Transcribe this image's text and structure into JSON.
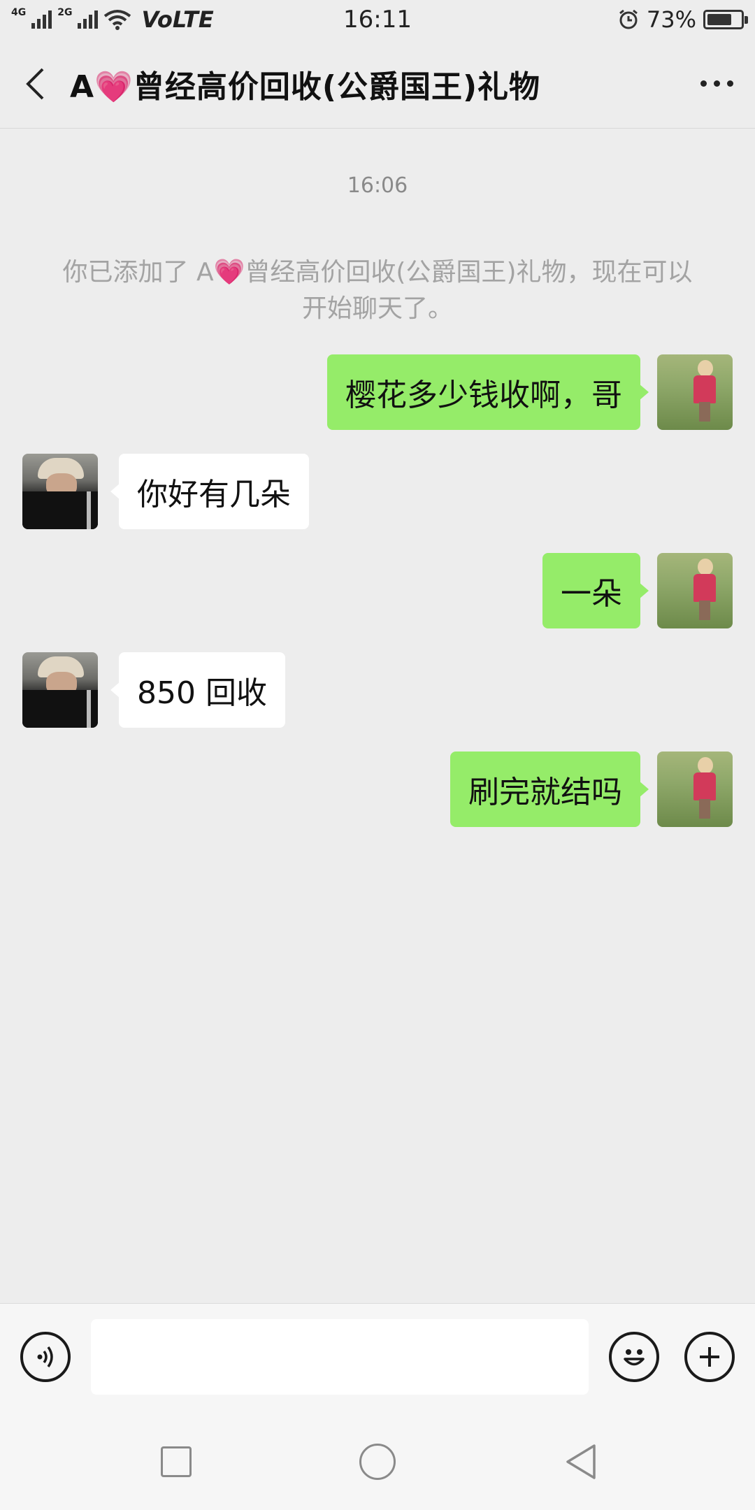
{
  "status_bar": {
    "net_4g": "4G",
    "net_2g": "2G",
    "volte": "VoLTE",
    "time": "16:11",
    "battery": "73%",
    "battery_level": 0.73
  },
  "header": {
    "title": "A💗曾经高价回收(公爵国王)礼物"
  },
  "chat": {
    "timestamp": "16:06",
    "system_message": "你已添加了 A💗曾经高价回收(公爵国王)礼物，现在可以开始聊天了。",
    "messages": [
      {
        "direction": "out",
        "text": "樱花多少钱收啊，哥"
      },
      {
        "direction": "in",
        "text": "你好有几朵"
      },
      {
        "direction": "out",
        "text": "一朵"
      },
      {
        "direction": "in",
        "text": "850 回收"
      },
      {
        "direction": "out",
        "text": "刷完就结吗"
      }
    ]
  },
  "input": {
    "value": "",
    "placeholder": ""
  },
  "colors": {
    "outgoing_bubble": "#95ec69",
    "incoming_bubble": "#ffffff",
    "background": "#ededed"
  }
}
